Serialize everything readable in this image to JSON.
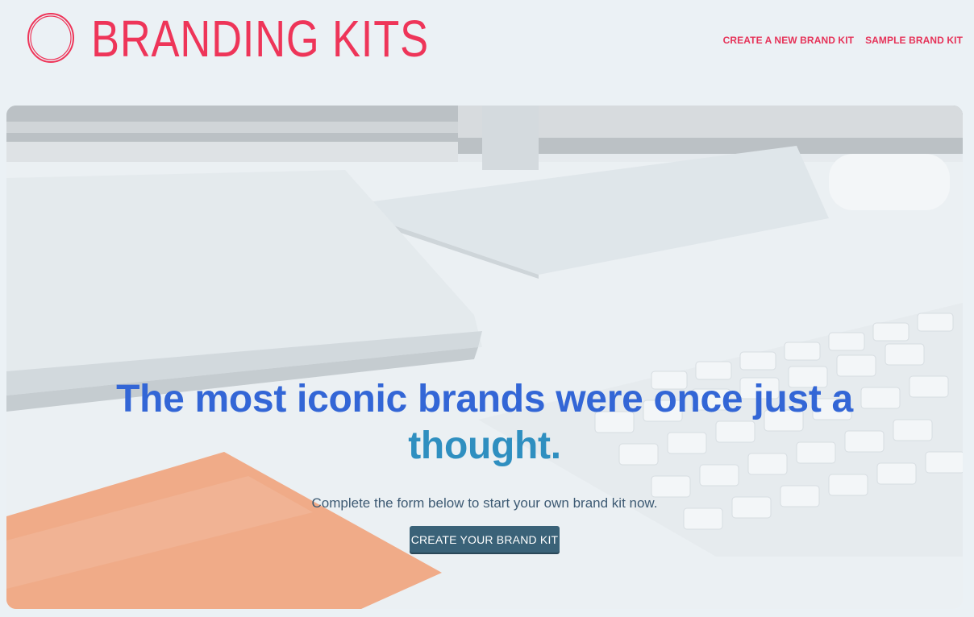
{
  "header": {
    "brand_name": "BRANDING KITS",
    "nav": [
      {
        "label": "CREATE A NEW BRAND KIT"
      },
      {
        "label": "SAMPLE BRAND KIT"
      }
    ]
  },
  "hero": {
    "headline_line1": "The most iconic brands were once just a",
    "headline_line2": "thought.",
    "subtext": "Complete the form below to start your own brand kit now.",
    "cta_label": "CREATE YOUR BRAND KIT"
  },
  "colors": {
    "brand": "#ee3559",
    "headline": "#3366d6",
    "cta": "#3a6278",
    "background": "#ebf1f5"
  }
}
